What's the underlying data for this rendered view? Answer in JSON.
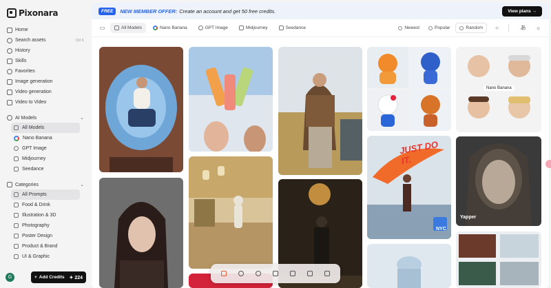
{
  "app": {
    "name": "Pixonara"
  },
  "sidebar": {
    "nav": [
      {
        "label": "Home",
        "icon": "home-icon"
      },
      {
        "label": "Search assets",
        "icon": "search-icon",
        "shortcut": "Ctrl K"
      },
      {
        "label": "History",
        "icon": "history-icon"
      },
      {
        "label": "Skills",
        "icon": "skills-icon"
      },
      {
        "label": "Favorites",
        "icon": "heart-icon"
      },
      {
        "label": "Image generation",
        "icon": "image-icon"
      },
      {
        "label": "Video generation",
        "icon": "video-icon"
      },
      {
        "label": "Video to Video",
        "icon": "video-transform-icon"
      }
    ],
    "ai_models": {
      "title": "AI Models",
      "items": [
        {
          "label": "All Models",
          "active": true
        },
        {
          "label": "Nano Banana"
        },
        {
          "label": "GPT Image"
        },
        {
          "label": "Midjourney"
        },
        {
          "label": "Seedance"
        }
      ]
    },
    "categories": {
      "title": "Categories",
      "items": [
        {
          "label": "All Prompts",
          "active": true
        },
        {
          "label": "Food & Drink"
        },
        {
          "label": "Illustration & 3D"
        },
        {
          "label": "Photography"
        },
        {
          "label": "Poster Design"
        },
        {
          "label": "Product & Brand"
        },
        {
          "label": "UI & Graphic"
        }
      ]
    },
    "footer": {
      "avatar_letter": "G",
      "add_credits_label": "Add Credits",
      "credits": "224"
    }
  },
  "banner": {
    "badge": "FREE",
    "title": "NEW MEMBER OFFER:",
    "text": "Create an account and get 50 free credits.",
    "cta": "View plans →"
  },
  "filters": {
    "models": [
      {
        "label": "All Models",
        "active": true
      },
      {
        "label": "Nano Banana"
      },
      {
        "label": "GPT Image"
      },
      {
        "label": "Midjourney"
      },
      {
        "label": "Seedance"
      }
    ],
    "sort": [
      {
        "label": "Newest"
      },
      {
        "label": "Popular"
      },
      {
        "label": "Random",
        "active": true
      }
    ]
  },
  "gallery": {
    "nano_banana_tag": "Nano Banana",
    "yapper_tag": "Yapper",
    "poster_slogan": "JUST DO IT.",
    "poster_city": "NYC"
  },
  "colors": {
    "accent": "#2563eb",
    "dark": "#111111"
  }
}
